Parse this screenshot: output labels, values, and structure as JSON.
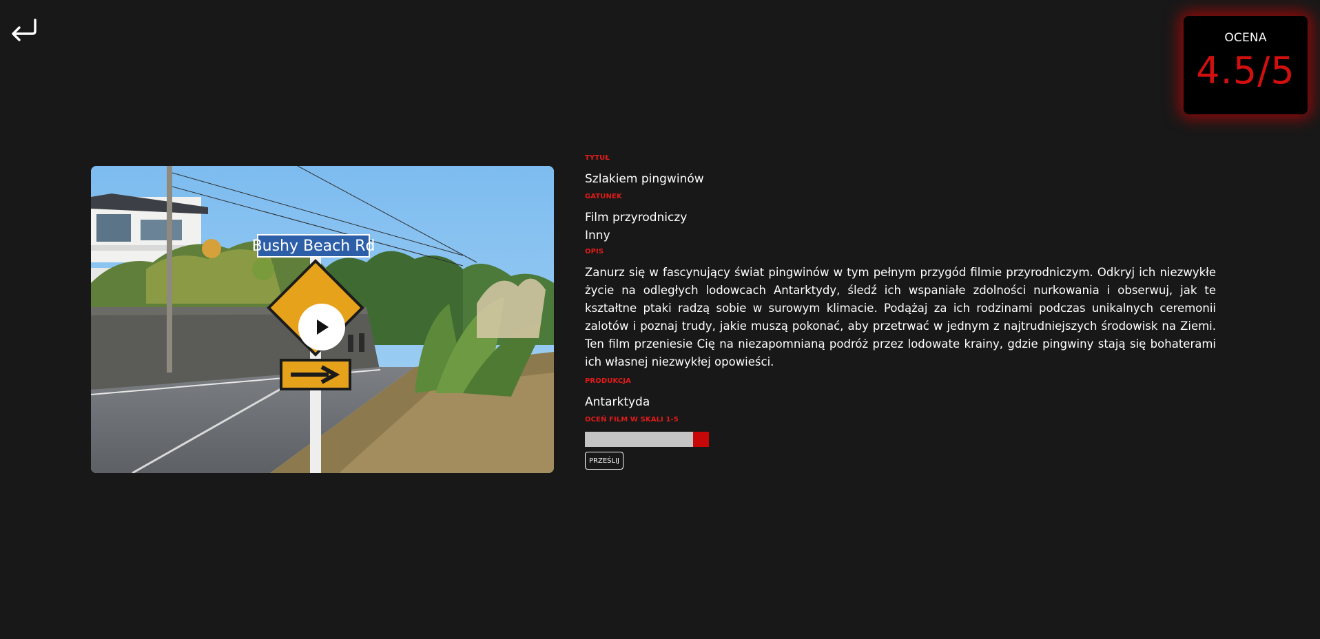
{
  "rating": {
    "label": "OCENA",
    "value": "4.5/5"
  },
  "media": {
    "sign_text": "Bushy Beach Rd",
    "play_icon": "play-icon"
  },
  "movie": {
    "title_label": "TYTUŁ",
    "title": "Szlakiem pingwinów",
    "genre_label": "GATUNEK",
    "genres": [
      "Film przyrodniczy",
      "Inny"
    ],
    "description_label": "OPIS",
    "description": "Zanurz się w fascynujący świat pingwinów w tym pełnym przygód filmie przyrodniczym. Odkryj ich niezwykłe życie na odległych lodowcach Antarktydy, śledź ich wspaniałe zdolności nurkowania i obserwuj, jak te kształtne ptaki radzą sobie w surowym klimacie. Podążaj za ich rodzinami podczas unikalnych ceremonii zalotów i poznaj trudy, jakie muszą pokonać, aby przetrwać w jednym z najtrudniejszych środowisk na Ziemi. Ten film przeniesie Cię na niezapomnianą podróż przez lodowate krainy, gdzie pingwiny stają się bohaterami ich własnej niezwykłej opowieści.",
    "production_label": "PRODUKCJA",
    "production": "Antarktyda"
  },
  "rate_form": {
    "label": "OCEŃ FILM W SKALI 1-5",
    "slider_value": 5,
    "slider_min": 1,
    "slider_max": 5,
    "submit_label": "PRZEŚLIJ"
  },
  "colors": {
    "background": "#181818",
    "accent": "#e31b1b",
    "rating_value": "#d20f0f"
  }
}
